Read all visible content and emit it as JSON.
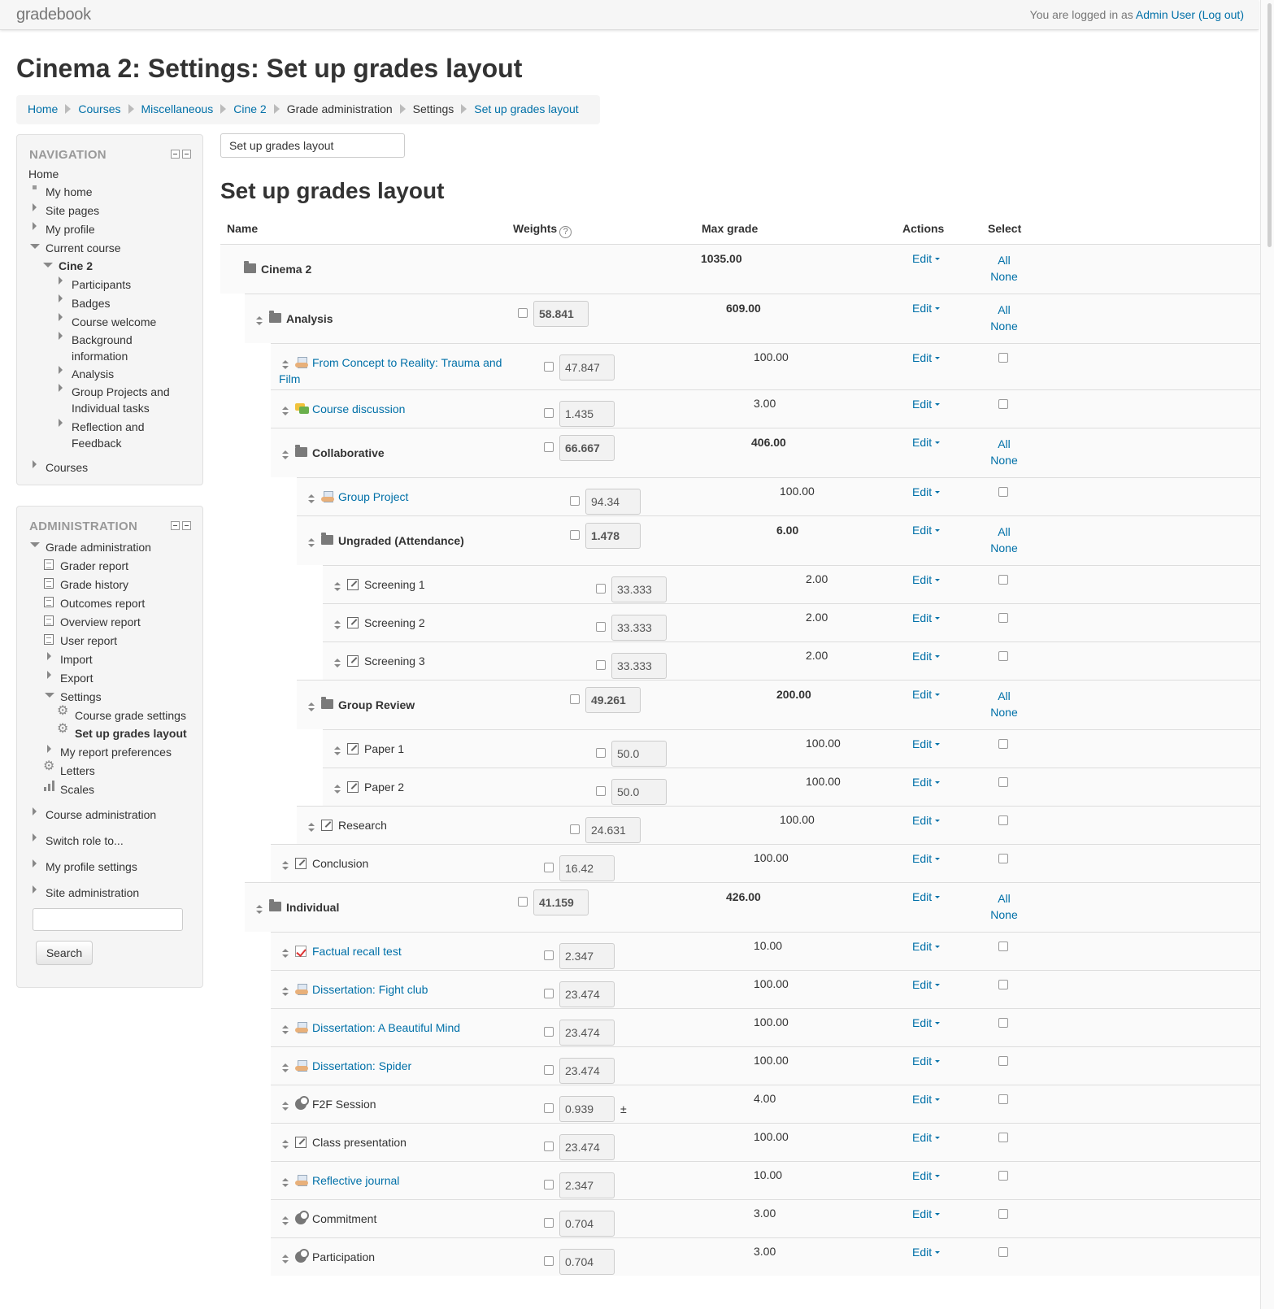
{
  "topbar": {
    "brand": "gradebook",
    "login_prefix": "You are logged in as ",
    "user": "Admin User",
    "logout": "(Log out)"
  },
  "page_title": "Cinema 2: Settings: Set up grades layout",
  "breadcrumb": [
    "Home",
    "Courses",
    "Miscellaneous",
    "Cine 2",
    "Grade administration",
    "Settings",
    "Set up grades layout"
  ],
  "navigation": {
    "title": "NAVIGATION",
    "home": "Home",
    "my_home": "My home",
    "site_pages": "Site pages",
    "my_profile": "My profile",
    "current_course": "Current course",
    "course": "Cine 2",
    "course_items": [
      "Participants",
      "Badges",
      "Course welcome",
      "Background information",
      "Analysis",
      "Group Projects and Individual tasks",
      "Reflection and Feedback"
    ],
    "courses": "Courses"
  },
  "administration": {
    "title": "ADMINISTRATION",
    "grade_admin": "Grade administration",
    "reports": [
      "Grader report",
      "Grade history",
      "Outcomes report",
      "Overview report",
      "User report"
    ],
    "import": "Import",
    "export": "Export",
    "settings": "Settings",
    "settings_items": [
      "Course grade settings",
      "Set up grades layout"
    ],
    "my_report_prefs": "My report preferences",
    "letters": "Letters",
    "scales": "Scales",
    "course_admin": "Course administration",
    "switch_role": "Switch role to...",
    "my_profile_settings": "My profile settings",
    "site_admin": "Site administration",
    "search_button": "Search",
    "search_value": ""
  },
  "jump_select": "Set up grades layout",
  "section_title": "Set up grades layout",
  "table": {
    "headers": {
      "name": "Name",
      "weights": "Weights",
      "help": "?",
      "max_grade": "Max grade",
      "actions": "Actions",
      "select": "Select"
    },
    "edit_label": "Edit",
    "all_label": "All",
    "none_label": "None",
    "plus": "±",
    "rows": [
      {
        "name": "Cinema 2",
        "type": "category",
        "weight": "",
        "max": "1035.00"
      },
      {
        "name": "Analysis",
        "type": "category",
        "weight": "58.841",
        "max": "609.00"
      },
      {
        "name": "From Concept to Reality: Trauma and",
        "name2": "Film",
        "type": "assign",
        "weight": "47.847",
        "max": "100.00"
      },
      {
        "name": "Course discussion",
        "type": "forum",
        "weight": "1.435",
        "max": "3.00"
      },
      {
        "name": "Collaborative",
        "type": "category",
        "weight": "66.667",
        "max": "406.00"
      },
      {
        "name": "Group Project",
        "type": "assign",
        "weight": "94.34",
        "max": "100.00"
      },
      {
        "name": "Ungraded (Attendance)",
        "type": "category",
        "weight": "1.478",
        "max": "6.00"
      },
      {
        "name": "Screening 1",
        "type": "manual",
        "weight": "33.333",
        "max": "2.00"
      },
      {
        "name": "Screening 2",
        "type": "manual",
        "weight": "33.333",
        "max": "2.00"
      },
      {
        "name": "Screening 3",
        "type": "manual",
        "weight": "33.333",
        "max": "2.00"
      },
      {
        "name": "Group Review",
        "type": "category",
        "weight": "49.261",
        "max": "200.00"
      },
      {
        "name": "Paper 1",
        "type": "manual",
        "weight": "50.0",
        "max": "100.00"
      },
      {
        "name": "Paper 2",
        "type": "manual",
        "weight": "50.0",
        "max": "100.00"
      },
      {
        "name": "Research",
        "type": "manual",
        "weight": "24.631",
        "max": "100.00"
      },
      {
        "name": "Conclusion",
        "type": "manual",
        "weight": "16.42",
        "max": "100.00"
      },
      {
        "name": "Individual",
        "type": "category",
        "weight": "41.159",
        "max": "426.00"
      },
      {
        "name": "Factual recall test",
        "type": "quiz",
        "weight": "2.347",
        "max": "10.00"
      },
      {
        "name": "Dissertation: Fight club",
        "type": "assign",
        "weight": "23.474",
        "max": "100.00"
      },
      {
        "name": "Dissertation: A Beautiful Mind",
        "type": "assign",
        "weight": "23.474",
        "max": "100.00"
      },
      {
        "name": "Dissertation: Spider",
        "type": "assign",
        "weight": "23.474",
        "max": "100.00"
      },
      {
        "name": "F2F Session",
        "type": "attendance",
        "weight": "0.939",
        "max": "4.00"
      },
      {
        "name": "Class presentation",
        "type": "manual",
        "weight": "23.474",
        "max": "100.00"
      },
      {
        "name": "Reflective journal",
        "type": "assign",
        "weight": "2.347",
        "max": "10.00"
      },
      {
        "name": "Commitment",
        "type": "attendance",
        "weight": "0.704",
        "max": "3.00"
      },
      {
        "name": "Participation",
        "type": "attendance",
        "weight": "0.704",
        "max": "3.00"
      }
    ]
  }
}
